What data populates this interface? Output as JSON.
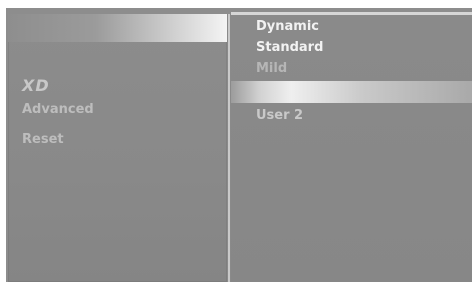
{
  "left_menu": {
    "items": [
      {
        "label": "",
        "style": "faint"
      },
      {
        "label": "XD",
        "style": "xd"
      },
      {
        "label": "Advanced",
        "style": "normal"
      },
      {
        "label": "Reset",
        "style": "normal"
      }
    ]
  },
  "right_menu": {
    "items": [
      {
        "label": "Dynamic"
      },
      {
        "label": "Standard"
      },
      {
        "label": "Mild"
      },
      {
        "label": ""
      },
      {
        "label": "User 2"
      }
    ]
  },
  "colors": {
    "panel": "#8a8a8a",
    "text_bright": "#f2f2f2",
    "text_dim": "#bdbdbd",
    "frame": "#ffffff"
  }
}
